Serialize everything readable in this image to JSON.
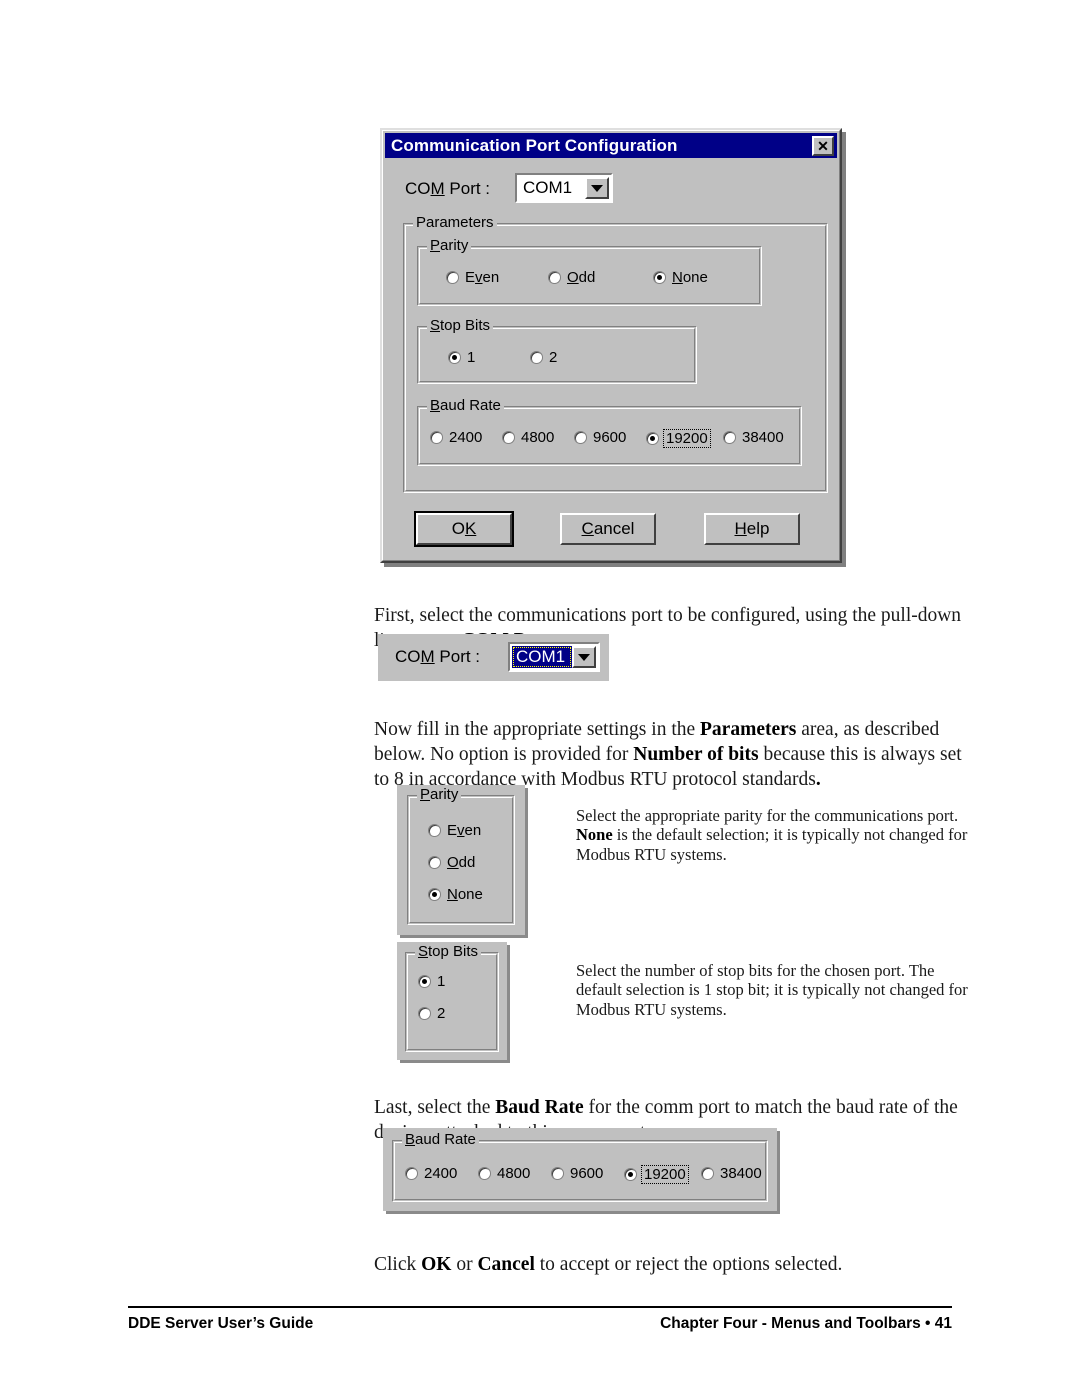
{
  "dialog": {
    "title": "Communication Port Configuration",
    "close_icon": "✕",
    "com_port_label_pre": "CO",
    "com_port_label_key": "M",
    "com_port_label_post": " Port  :",
    "com_port_value": "COM1",
    "parameters_group": "Parameters",
    "parity": {
      "group_label_key": "P",
      "group_label_rest": "arity",
      "options": [
        {
          "pre": "E",
          "key": "v",
          "post": "en",
          "selected": false
        },
        {
          "pre": "",
          "key": "O",
          "post": "dd",
          "selected": false
        },
        {
          "pre": "",
          "key": "N",
          "post": "one",
          "selected": true
        }
      ]
    },
    "stop_bits": {
      "group_label_key": "S",
      "group_label_rest": "top Bits",
      "options": [
        {
          "label": "1",
          "selected": true
        },
        {
          "label": "2",
          "selected": false
        }
      ]
    },
    "baud_rate": {
      "group_label_key": "B",
      "group_label_rest": "aud Rate",
      "options": [
        {
          "label": "2400",
          "selected": false,
          "focused": false
        },
        {
          "label": "4800",
          "selected": false,
          "focused": false
        },
        {
          "label": "9600",
          "selected": false,
          "focused": false
        },
        {
          "label": "19200",
          "selected": true,
          "focused": true
        },
        {
          "label": "38400",
          "selected": false,
          "focused": false
        }
      ]
    },
    "buttons": [
      {
        "pre": "O",
        "key": "K",
        "post": "",
        "default": true
      },
      {
        "pre": "",
        "key": "C",
        "post": "ancel",
        "default": false
      },
      {
        "pre": "",
        "key": "H",
        "post": "elp",
        "default": false
      }
    ]
  },
  "body": {
    "para1_a": "First, select the communications port to be configured, using the pull-down list next to ",
    "para1_b": "COM Port",
    "para1_c": ":",
    "para2_a": "Now fill in the appropriate settings in the ",
    "para2_b": "Parameters",
    "para2_c": " area, as described below. No option is provided for ",
    "para2_d": "Number of bits",
    "para2_e": " because this is always set to 8 in accordance with Modbus RTU protocol standards",
    "para2_f": ".",
    "para3_a": "Last, select the ",
    "para3_b": "Baud Rate",
    "para3_c": " for the comm port to match the baud rate of the devices attached to this comm port:",
    "para4_a": "Click ",
    "para4_b": "OK",
    "para4_c": " or ",
    "para4_d": "Cancel",
    "para4_e": " to accept or reject the options selected."
  },
  "detail_comport": {
    "label_pre": "CO",
    "label_key": "M",
    "label_post": " Port  :",
    "value": "COM1"
  },
  "detail_parity": {
    "group_label_key": "P",
    "group_label_rest": "arity",
    "options": [
      {
        "pre": "E",
        "key": "v",
        "post": "en",
        "selected": false
      },
      {
        "pre": "",
        "key": "O",
        "post": "dd",
        "selected": false
      },
      {
        "pre": "",
        "key": "N",
        "post": "one",
        "selected": true
      }
    ],
    "description_a": "Select the appropriate parity for the communications port. ",
    "description_b": "None",
    "description_c": " is the default selection; it is typically not changed for Modbus RTU systems."
  },
  "detail_stopbits": {
    "group_label_key": "S",
    "group_label_rest": "top Bits",
    "options": [
      {
        "label": "1",
        "selected": true
      },
      {
        "label": "2",
        "selected": false
      }
    ],
    "description": "Select the number of stop bits for the chosen port. The default selection is 1 stop bit; it is typically not changed for Modbus RTU systems."
  },
  "detail_baudrate": {
    "group_label_key": "B",
    "group_label_rest": "aud Rate",
    "options": [
      {
        "label": "2400",
        "selected": false,
        "focused": false
      },
      {
        "label": "4800",
        "selected": false,
        "focused": false
      },
      {
        "label": "9600",
        "selected": false,
        "focused": false
      },
      {
        "label": "19200",
        "selected": true,
        "focused": true
      },
      {
        "label": "38400",
        "selected": false,
        "focused": false
      }
    ]
  },
  "footer": {
    "left": "DDE Server User’s Guide",
    "right": "Chapter Four - Menus and Toolbars • 41"
  },
  "colors": {
    "titlebar": "#000087",
    "face": "#c0c0c0",
    "highlight": "#000087",
    "focus_outline": "#ffff00"
  }
}
